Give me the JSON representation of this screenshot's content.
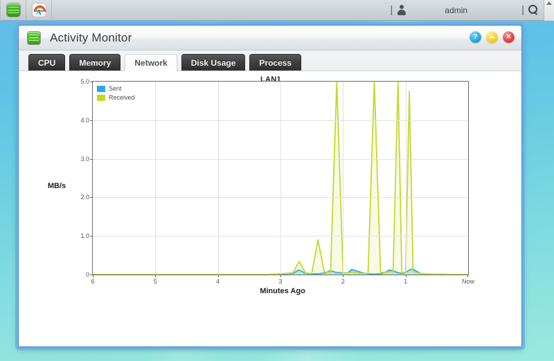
{
  "topbar": {
    "app_icons": [
      "activity-monitor-icon",
      "rainbow-a-icon"
    ],
    "user_icon": "user-icon",
    "user_label": "admin",
    "search_icon": "search-icon",
    "separator": "|",
    "scroll_up_icon": "scroll-up-arrow"
  },
  "window": {
    "icon": "activity-monitor-icon",
    "title": "Activity Monitor",
    "buttons": {
      "help_label": "?",
      "minimize_label": "",
      "close_label": "✕"
    }
  },
  "tabs": [
    {
      "label": "CPU",
      "active": false
    },
    {
      "label": "Memory",
      "active": false
    },
    {
      "label": "Network",
      "active": true
    },
    {
      "label": "Disk Usage",
      "active": false
    },
    {
      "label": "Process",
      "active": false
    }
  ],
  "watermark": "",
  "chart_data": {
    "type": "line",
    "title": "LAN1",
    "xlabel": "Minutes Ago",
    "ylabel": "MB/s",
    "grid": true,
    "legend_position": "top-left",
    "xlim": [
      6,
      0
    ],
    "ylim": [
      0,
      5.0
    ],
    "xticks": [
      6,
      5,
      4,
      3,
      2,
      1,
      0
    ],
    "xticklabels": [
      "6",
      "5",
      "4",
      "3",
      "2",
      "1",
      "Now"
    ],
    "yticks": [
      0,
      1.0,
      2.0,
      3.0,
      4.0,
      5.0
    ],
    "yticklabels": [
      "0",
      "1.0",
      "2.0",
      "3.0",
      "4.0",
      "5.0"
    ],
    "colors": {
      "sent": "#29abe2",
      "received": "#c3d92b"
    },
    "x": [
      6.0,
      5.75,
      5.5,
      5.25,
      5.0,
      4.75,
      4.5,
      4.25,
      4.0,
      3.75,
      3.5,
      3.25,
      3.0,
      2.9,
      2.8,
      2.7,
      2.6,
      2.5,
      2.4,
      2.3,
      2.2,
      2.1,
      2.0,
      1.92,
      1.86,
      1.8,
      1.7,
      1.6,
      1.5,
      1.4,
      1.32,
      1.26,
      1.2,
      1.12,
      1.06,
      1.0,
      0.94,
      0.88,
      0.82,
      0.76,
      0.7,
      0.55,
      0.4,
      0.25,
      0.1,
      0.0
    ],
    "series": [
      {
        "name": "Sent",
        "color": "#29abe2",
        "values": [
          0,
          0,
          0,
          0,
          0,
          0,
          0,
          0,
          0,
          0,
          0,
          0,
          0.01,
          0.02,
          0.03,
          0.12,
          0.03,
          0.02,
          0.02,
          0.04,
          0.1,
          0.05,
          0.04,
          0.05,
          0.13,
          0.1,
          0.05,
          0.02,
          0.01,
          0.02,
          0.06,
          0.12,
          0.09,
          0.05,
          0.03,
          0.05,
          0.12,
          0.14,
          0.08,
          0.03,
          0.01,
          0.01,
          0.0,
          0.0,
          0.0,
          0.0
        ]
      },
      {
        "name": "Received",
        "color": "#c3d92b",
        "values": [
          0,
          0,
          0,
          0,
          0,
          0,
          0,
          0,
          0,
          0,
          0,
          0,
          0.02,
          0.03,
          0.05,
          0.34,
          0.04,
          0.03,
          0.9,
          0.07,
          0.06,
          5.0,
          0.05,
          0.04,
          0.07,
          0.05,
          0.03,
          0.03,
          5.0,
          0.06,
          0.05,
          0.08,
          0.07,
          5.0,
          0.05,
          0.06,
          4.75,
          0.09,
          0.05,
          0.03,
          0.02,
          0.01,
          0.01,
          0.0,
          0.0,
          0.0
        ]
      }
    ],
    "notes": "Received shows four tall spikes reaching the 5.0 ceiling (one slightly lower near 4.75) between 2 and 1 minutes ago; Sent stays under 0.2 MB/s throughout."
  }
}
